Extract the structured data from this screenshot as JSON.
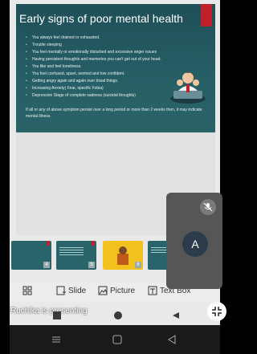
{
  "slide": {
    "title": "Early signs of poor mental health",
    "bullets": [
      "You always feel drained or exhausted.",
      "Trouble sleeping",
      "You feel mentally or emotionally disturbed and excessive anger issues",
      "Having persistent thoughts and memories you can't get out of your head.",
      "You like and feel loneliness.",
      "You feel confused, upset, worried and low confident.",
      "Getting angry again and again over trivial things.",
      "Increasing Anxiety( Fear, specific Fobia)",
      "Depression Stage of complete sadness (suicidal thoughts)"
    ],
    "closing": "If all or any of above symptom persist over a long period or more than 2 weeks then, it may indicate mental illness."
  },
  "thumbnails": [
    {
      "number": "4",
      "style": "teal"
    },
    {
      "number": "5",
      "style": "teal"
    },
    {
      "number": "6",
      "style": "yellow"
    },
    {
      "number": "",
      "style": "teal"
    }
  ],
  "toolbar": {
    "layout_icon": "grid-icon",
    "slide_label": "Slide",
    "picture_label": "Picture",
    "textbox_label": "Text Box"
  },
  "status": {
    "presenting_text": "Ruchika is presenting"
  },
  "participant": {
    "initial": "A",
    "mic_icon": "mic-off-icon"
  },
  "icons": {
    "exit_fullscreen": "exit-fullscreen-icon",
    "nav_recent": "recents-icon",
    "nav_home": "home-icon",
    "nav_back": "back-icon"
  },
  "colors": {
    "slide_bg": "#275f66",
    "accent_red": "#c0202a",
    "avatar_bg": "#2c3c4a",
    "overlay_bg": "#565656"
  }
}
